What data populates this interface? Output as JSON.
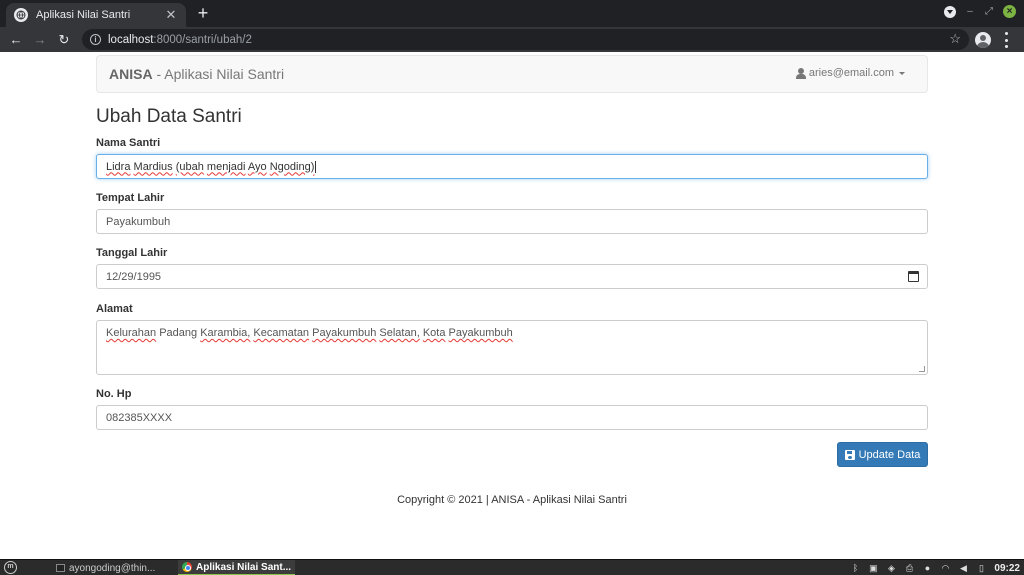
{
  "browser": {
    "tab_title": "Aplikasi Nilai Santri",
    "tab_close": "✕",
    "new_tab": "+",
    "url_host": "localhost",
    "url_path": ":8000/santri/ubah/2",
    "icons": [
      "globe-icon",
      "back-icon",
      "forward-icon",
      "reload-icon",
      "info-icon",
      "star-icon",
      "profile-icon",
      "menu-icon"
    ]
  },
  "navbar": {
    "brand_name": "ANISA",
    "brand_suffix": " - Aplikasi Nilai Santri",
    "user_email": "aries@email.com"
  },
  "page": {
    "title": "Ubah Data Santri"
  },
  "form": {
    "nama": {
      "label": "Nama Santri",
      "value_parts": [
        "Lidra",
        " ",
        "Mardius",
        " ",
        "(ubah",
        " ",
        "menjadi",
        " ",
        "Ayo",
        " ",
        "Ngoding)"
      ]
    },
    "tempat_lahir": {
      "label": "Tempat Lahir",
      "value": "Payakumbuh"
    },
    "tanggal_lahir": {
      "label": "Tanggal Lahir",
      "value": "12/29/1995"
    },
    "alamat": {
      "label": "Alamat",
      "value_parts": [
        "Kelurahan",
        " Padang ",
        "Karambia,",
        " ",
        "Kecamatan",
        " ",
        "Payakumbuh",
        " ",
        "Selatan,",
        " ",
        "Kota",
        " ",
        "Payakumbuh"
      ]
    },
    "no_hp": {
      "label": "No. Hp",
      "value": "082385XXXX"
    },
    "submit_label": "Update Data"
  },
  "footer": {
    "text": "Copyright © 2021 | ANISA - Aplikasi Nilai Santri"
  },
  "taskbar": {
    "start_label": "m",
    "terminal_task": "ayongoding@thin...",
    "browser_task": "Aplikasi Nilai Sant...",
    "clock": "09:22",
    "accent": "#8bc34a"
  },
  "colors": {
    "primary_button": "#337ab7",
    "focus_border": "#66afe9",
    "chrome_dark": "#202124"
  }
}
